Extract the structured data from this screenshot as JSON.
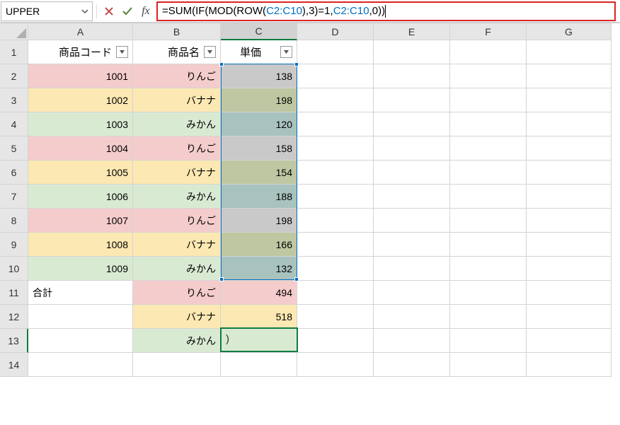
{
  "namebox": "UPPER",
  "formula": {
    "p1": "=SUM(IF(MOD(ROW(",
    "p2": "C2:C10",
    "p3": "),3)=1, ",
    "p4": "C2:C10",
    "p5": ",0))"
  },
  "columns": [
    "A",
    "B",
    "C",
    "D",
    "E",
    "F",
    "G"
  ],
  "rows": [
    "1",
    "2",
    "3",
    "4",
    "5",
    "6",
    "7",
    "8",
    "9",
    "10",
    "11",
    "12",
    "13",
    "14"
  ],
  "headers": {
    "code": "商品コード",
    "name": "商品名",
    "price": "単価"
  },
  "data": [
    {
      "code": "1001",
      "name": "りんご",
      "price": "138"
    },
    {
      "code": "1002",
      "name": "バナナ",
      "price": "198"
    },
    {
      "code": "1003",
      "name": "みかん",
      "price": "120"
    },
    {
      "code": "1004",
      "name": "りんご",
      "price": "158"
    },
    {
      "code": "1005",
      "name": "バナナ",
      "price": "154"
    },
    {
      "code": "1006",
      "name": "みかん",
      "price": "188"
    },
    {
      "code": "1007",
      "name": "りんご",
      "price": "198"
    },
    {
      "code": "1008",
      "name": "バナナ",
      "price": "166"
    },
    {
      "code": "1009",
      "name": "みかん",
      "price": "132"
    }
  ],
  "totalLabel": "合計",
  "totals": [
    {
      "name": "りんご",
      "price": "494"
    },
    {
      "name": "バナナ",
      "price": "518"
    },
    {
      "name": "みかん",
      "price": ")"
    }
  ]
}
